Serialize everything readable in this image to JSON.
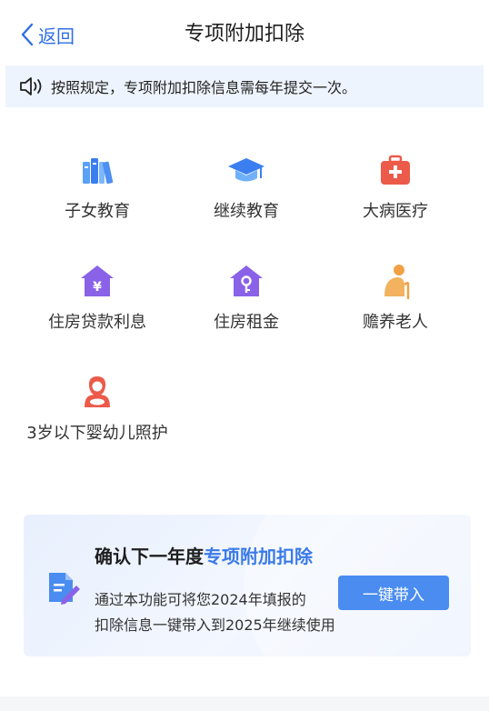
{
  "nav": {
    "back_label": "返回",
    "title": "专项附加扣除"
  },
  "notice": {
    "text": "按照规定，专项附加扣除信息需每年提交一次。"
  },
  "items": [
    {
      "label": "子女教育",
      "icon": "books-icon"
    },
    {
      "label": "继续教育",
      "icon": "graduation-cap-icon"
    },
    {
      "label": "大病医疗",
      "icon": "medical-kit-icon"
    },
    {
      "label": "住房贷款利息",
      "icon": "house-yuan-icon"
    },
    {
      "label": "住房租金",
      "icon": "house-key-icon"
    },
    {
      "label": "赡养老人",
      "icon": "elderly-icon"
    },
    {
      "label": "3岁以下婴幼儿照护",
      "icon": "infant-care-icon"
    }
  ],
  "card": {
    "title_prefix": "确认下一年度",
    "title_highlight": "专项附加扣除",
    "desc_line1": "通过本功能可将您2024年填报的",
    "desc_line2": "扣除信息一键带入到2025年继续使用",
    "button_label": "一键带入"
  },
  "colors": {
    "accent": "#2f6fe6",
    "button": "#4a8cf0",
    "notice_bg": "#eef4fd"
  }
}
